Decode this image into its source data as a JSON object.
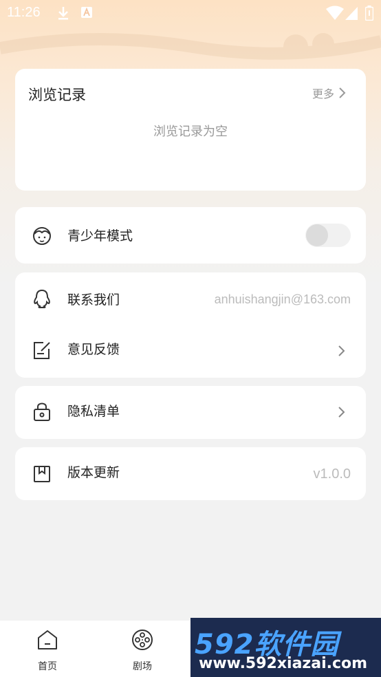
{
  "status_bar": {
    "time": "11:26"
  },
  "history": {
    "title": "浏览记录",
    "more_label": "更多",
    "empty_text": "浏览记录为空"
  },
  "teen_mode": {
    "label": "青少年模式",
    "enabled": false
  },
  "contact": {
    "label": "联系我们",
    "value": "anhuishangjin@163.com"
  },
  "feedback": {
    "label": "意见反馈"
  },
  "privacy": {
    "label": "隐私清单"
  },
  "version": {
    "label": "版本更新",
    "value": "v1.0.0"
  },
  "tabbar": {
    "items": [
      {
        "label": "首页",
        "icon": "home-icon"
      },
      {
        "label": "剧场",
        "icon": "film-reel-icon"
      }
    ]
  },
  "watermark": {
    "brand": "592软件园",
    "url": "www.592xiazai.com"
  }
}
